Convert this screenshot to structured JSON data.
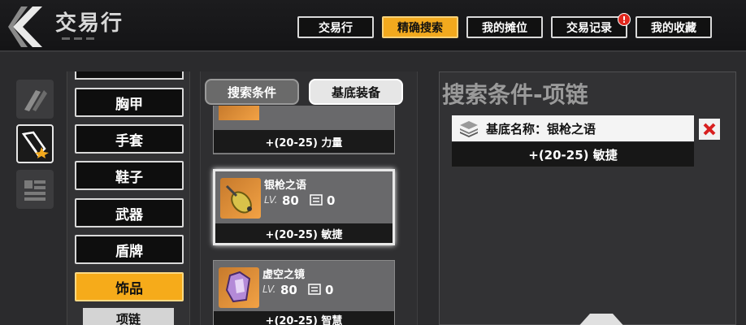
{
  "header": {
    "title": "交易行",
    "tabs": [
      {
        "label": "交易行",
        "active": false
      },
      {
        "label": "精确搜索",
        "active": true
      },
      {
        "label": "我的摊位",
        "active": false
      },
      {
        "label": "交易记录",
        "active": false
      },
      {
        "label": "我的收藏",
        "active": false
      }
    ],
    "badge": "!"
  },
  "sidebar": {
    "icons": [
      "equipment-icon",
      "accessory-icon",
      "material-icon"
    ]
  },
  "categories": {
    "items": [
      {
        "label": "胸甲",
        "active": false
      },
      {
        "label": "手套",
        "active": false
      },
      {
        "label": "鞋子",
        "active": false
      },
      {
        "label": "武器",
        "active": false
      },
      {
        "label": "盾牌",
        "active": false
      },
      {
        "label": "饰品",
        "active": true
      }
    ],
    "sub_item": "项链"
  },
  "list": {
    "subtabs": {
      "search": "搜索条件",
      "base": "基底装备"
    },
    "top_card_stat": "+(20-25) 力量",
    "cards": [
      {
        "name": "银枪之语",
        "lv_label": "LV.",
        "level": "80",
        "stack": "0",
        "stat": "+(20-25) 敏捷",
        "selected": true
      },
      {
        "name": "虚空之镜",
        "lv_label": "LV.",
        "level": "80",
        "stack": "0",
        "stat": "+(20-25) 智慧",
        "selected": false
      }
    ]
  },
  "right": {
    "title": "搜索条件-项链",
    "condition_label": "基底名称：银枪之语",
    "condition_stat": "+(20-25) 敏捷"
  },
  "colors": {
    "accent": "#f6ab1a",
    "background": "#2b2b2d",
    "delete": "#d81e1e"
  }
}
